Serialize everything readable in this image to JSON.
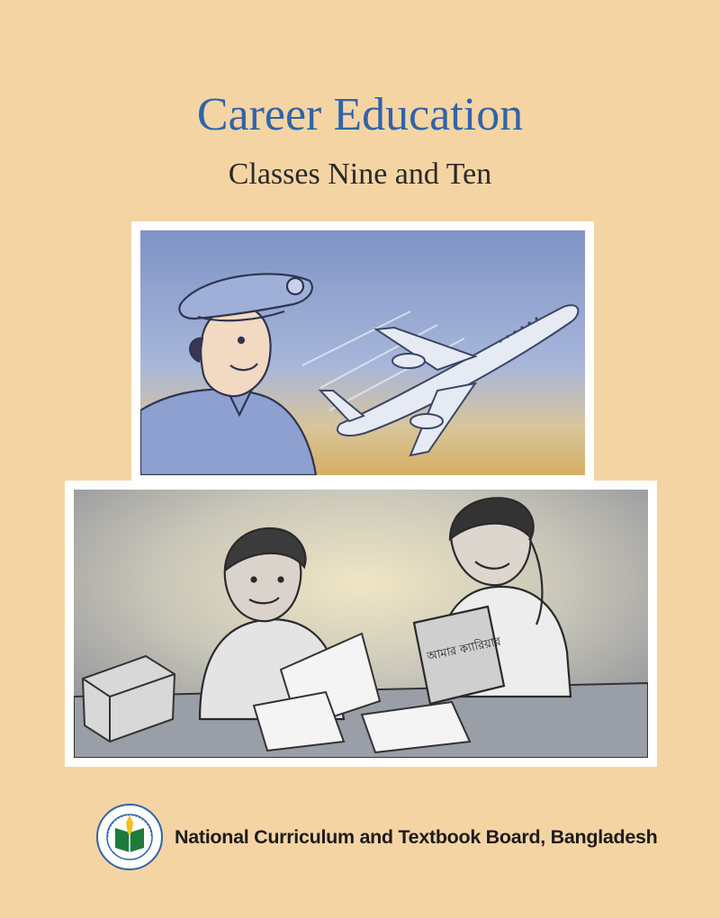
{
  "cover": {
    "title": "Career Education",
    "subtitle": "Classes Nine and Ten"
  },
  "illustrations": {
    "top": {
      "depicts": "pilot-and-airplane"
    },
    "bottom": {
      "depicts": "students-reading",
      "book_label": "আমার ক্যারিয়ার"
    }
  },
  "footer": {
    "publisher": "National Curriculum and Textbook Board, Bangladesh",
    "logo_icon": "nctb-emblem-icon"
  },
  "colors": {
    "background": "#f5d4a4",
    "title": "#2f64a8",
    "frame": "#ffffff"
  }
}
